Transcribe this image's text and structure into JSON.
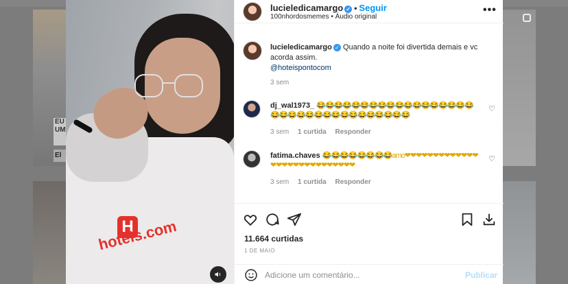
{
  "post": {
    "username": "lucieledicamargo",
    "follow_label": "Seguir",
    "separator": "•",
    "audio_line": "100nhordosmemes • Áudio original",
    "more_label": "•••"
  },
  "caption": {
    "username": "lucieledicamargo",
    "text": "Quando a noite foi divertida demais e vc acorda assim.",
    "mention": "@hoteispontocom",
    "time": "3 sem"
  },
  "comments": [
    {
      "username": "dj_wal1973_",
      "text": "😂😂😂😂😂😂😂😂😂😂😂😂😂😂😂😂😂😂😂😂😂😂😂😂😂😂😂😂😂😂😂😂😂😂",
      "time": "3 sem",
      "likes": "1 curtida",
      "reply": "Responder"
    },
    {
      "username": "fatima.chaves",
      "text": "😂😂😂😂😂😂😂😂amo❤❤❤❤❤❤❤❤❤❤❤❤❤❤❤❤❤❤❤❤❤❤❤❤❤❤❤❤",
      "time": "3 sem",
      "likes": "1 curtida",
      "reply": "Responder"
    }
  ],
  "stats": {
    "likes": "11.664 curtidas",
    "date": "1 DE MAIO"
  },
  "composer": {
    "placeholder": "Adicione um comentário...",
    "publish_label": "Publicar"
  },
  "video": {
    "brand_text": "hoteis.com",
    "logo_letter": "H"
  },
  "background": {
    "label_1": "EU UM",
    "label_2": "El"
  },
  "colors": {
    "accent": "#0095f6",
    "verified": "#3897f0",
    "brand_red": "#e4312c"
  }
}
